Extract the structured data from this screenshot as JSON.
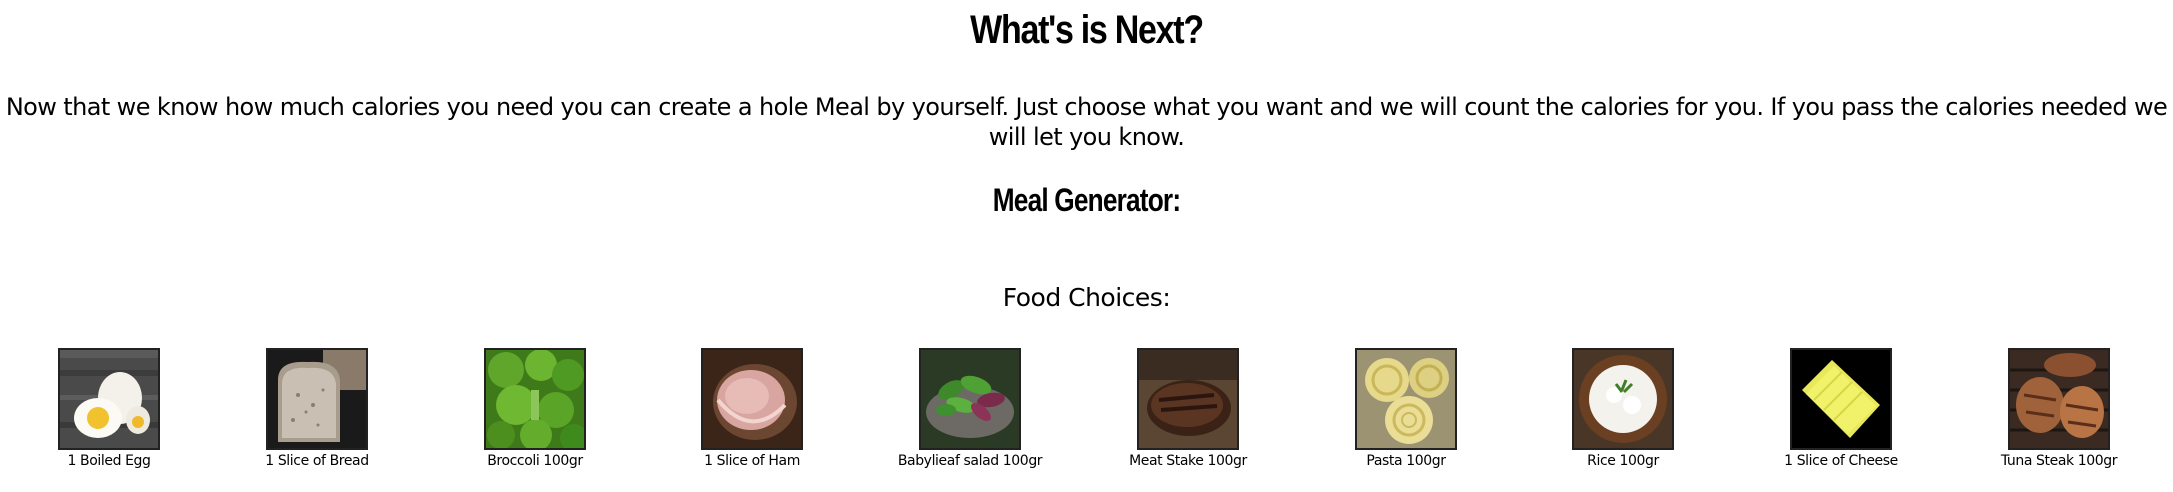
{
  "heading": "What's is Next?",
  "intro": "Now that we know how much calories you need you can create a hole Meal by yourself. Just choose what you want and we will count the calories for you. If you pass the calories needed we will let you know.",
  "meal_generator_label": "Meal Generator:",
  "food_choices_label": "Food Choices:",
  "foods": [
    {
      "label": "1 Boiled Egg",
      "icon": "boiled-egg-image"
    },
    {
      "label": "1 Slice of Bread",
      "icon": "bread-image"
    },
    {
      "label": "Broccoli 100gr",
      "icon": "broccoli-image"
    },
    {
      "label": "1 Slice of Ham",
      "icon": "ham-image"
    },
    {
      "label": "Babylieaf salad 100gr",
      "icon": "salad-image"
    },
    {
      "label": "Meat Stake 100gr",
      "icon": "steak-image"
    },
    {
      "label": "Pasta 100gr",
      "icon": "pasta-image"
    },
    {
      "label": "Rice 100gr",
      "icon": "rice-image"
    },
    {
      "label": "1 Slice of Cheese",
      "icon": "cheese-image"
    },
    {
      "label": "Tuna Steak 100gr",
      "icon": "tuna-steak-image"
    }
  ]
}
